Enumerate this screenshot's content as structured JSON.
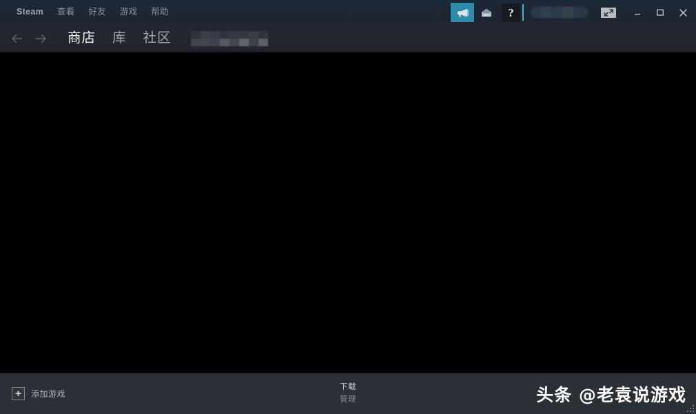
{
  "window": {
    "app_name": "Steam",
    "controls": {
      "minimize": "–",
      "maximize": "□",
      "close": "✕"
    }
  },
  "titlebar": {
    "menu": [
      {
        "label": "Steam",
        "name": "menu-steam"
      },
      {
        "label": "查看",
        "name": "menu-view"
      },
      {
        "label": "好友",
        "name": "menu-friends"
      },
      {
        "label": "游戏",
        "name": "menu-games"
      },
      {
        "label": "帮助",
        "name": "menu-help"
      }
    ],
    "broadcast_icon": "megaphone-icon",
    "mail_icon": "envelope-icon",
    "help_label": "?",
    "username_masked": "",
    "expand_icon": "expand-arrows-icon",
    "accent_color": "#3fb6d4",
    "broadcast_color": "#2d8bab"
  },
  "nav": {
    "back_icon": "←",
    "forward_icon": "→",
    "tabs": [
      {
        "label": "商店",
        "name": "tab-store",
        "active": true
      },
      {
        "label": "库",
        "name": "tab-library",
        "active": false
      },
      {
        "label": "社区",
        "name": "tab-community",
        "active": false
      }
    ],
    "profile_masked": ""
  },
  "main": {
    "background_color": "#000000",
    "content": ""
  },
  "bottombar": {
    "add_game_icon": "+",
    "add_game_label": "添加游戏",
    "downloads_title": "下载",
    "downloads_sub": "管理",
    "watermark": "头条 @老袁说游戏",
    "resize_grip": "resize-grip"
  }
}
